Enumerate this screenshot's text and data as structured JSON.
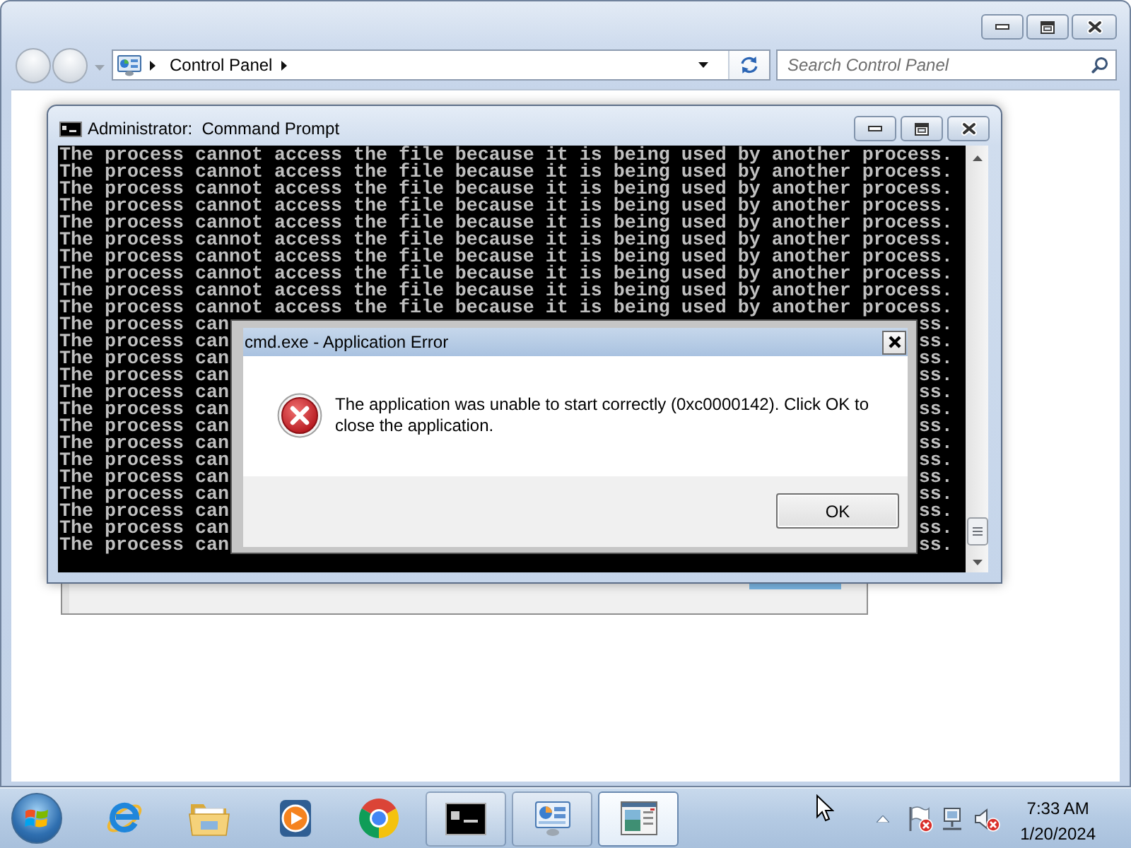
{
  "explorer": {
    "address_bar": {
      "path": [
        "Control Panel"
      ]
    },
    "search": {
      "placeholder": "Search Control Panel"
    }
  },
  "console_window": {
    "title": "Administrator:  Command Prompt",
    "lines": [
      {
        "kind": "full",
        "text": "The process cannot access the file because it is being used by another process."
      },
      {
        "kind": "full",
        "text": "The process cannot access the file because it is being used by another process."
      },
      {
        "kind": "full",
        "text": "The process cannot access the file because it is being used by another process."
      },
      {
        "kind": "full",
        "text": "The process cannot access the file because it is being used by another process."
      },
      {
        "kind": "full",
        "text": "The process cannot access the file because it is being used by another process."
      },
      {
        "kind": "full",
        "text": "The process cannot access the file because it is being used by another process."
      },
      {
        "kind": "full",
        "text": "The process cannot access the file because it is being used by another process."
      },
      {
        "kind": "full",
        "text": "The process cannot access the file because it is being used by another process."
      },
      {
        "kind": "full",
        "text": "The process cannot access the file because it is being used by another process."
      },
      {
        "kind": "full",
        "text": "The process cannot access the file because it is being used by another process."
      },
      {
        "kind": "split",
        "start": "The process can",
        "end": "ss."
      },
      {
        "kind": "split",
        "start": "The process can",
        "end": "ss."
      },
      {
        "kind": "split",
        "start": "The process can",
        "end": "ss."
      },
      {
        "kind": "split",
        "start": "The process can",
        "end": "ss."
      },
      {
        "kind": "split",
        "start": "The process can",
        "end": "ss."
      },
      {
        "kind": "split",
        "start": "The process can",
        "end": "ss."
      },
      {
        "kind": "split",
        "start": "The process can",
        "end": "ss."
      },
      {
        "kind": "split",
        "start": "The process can",
        "end": "ss."
      },
      {
        "kind": "split",
        "start": "The process can",
        "end": "ss."
      },
      {
        "kind": "split",
        "start": "The process can",
        "end": "ss."
      },
      {
        "kind": "split",
        "start": "The process can",
        "end": "ss."
      },
      {
        "kind": "split",
        "start": "The process can",
        "end": "ss."
      },
      {
        "kind": "split",
        "start": "The process can",
        "end": "ss."
      },
      {
        "kind": "split",
        "start": "The process can",
        "end": "ss."
      }
    ]
  },
  "error_dialog": {
    "title": "cmd.exe - Application Error",
    "message": "The application was unable to start correctly (0xc0000142). Click OK to close the application.",
    "buttons": [
      "OK"
    ]
  },
  "taskbar": {
    "task_buttons": [
      {
        "kind": "console",
        "selected": false
      },
      {
        "kind": "control-panel",
        "selected": false
      },
      {
        "kind": "window",
        "selected": true
      }
    ],
    "clock": {
      "time": "7:33 AM",
      "date": "1/20/2024"
    }
  }
}
